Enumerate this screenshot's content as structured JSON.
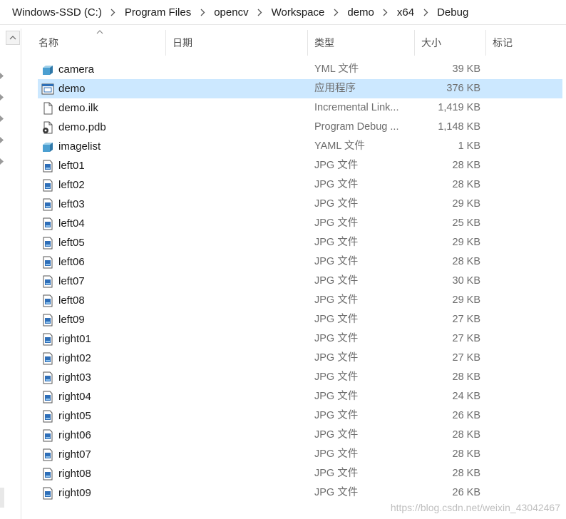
{
  "breadcrumb": [
    "Windows-SSD (C:)",
    "Program Files",
    "opencv",
    "Workspace",
    "demo",
    "x64",
    "Debug"
  ],
  "columns": {
    "name": "名称",
    "date": "日期",
    "type": "类型",
    "size": "大小",
    "tags": "标记"
  },
  "files": [
    {
      "name": "camera",
      "type": "YML 文件",
      "size": "39 KB",
      "icon": "yml-file-icon",
      "selected": false
    },
    {
      "name": "demo",
      "type": "应用程序",
      "size": "376 KB",
      "icon": "exe-file-icon",
      "selected": true
    },
    {
      "name": "demo.ilk",
      "type": "Incremental Link...",
      "size": "1,419 KB",
      "icon": "ilk-file-icon",
      "selected": false
    },
    {
      "name": "demo.pdb",
      "type": "Program Debug ...",
      "size": "1,148 KB",
      "icon": "pdb-file-icon",
      "selected": false
    },
    {
      "name": "imagelist",
      "type": "YAML 文件",
      "size": "1 KB",
      "icon": "yml-file-icon",
      "selected": false
    },
    {
      "name": "left01",
      "type": "JPG 文件",
      "size": "28 KB",
      "icon": "jpg-file-icon",
      "selected": false
    },
    {
      "name": "left02",
      "type": "JPG 文件",
      "size": "28 KB",
      "icon": "jpg-file-icon",
      "selected": false
    },
    {
      "name": "left03",
      "type": "JPG 文件",
      "size": "29 KB",
      "icon": "jpg-file-icon",
      "selected": false
    },
    {
      "name": "left04",
      "type": "JPG 文件",
      "size": "25 KB",
      "icon": "jpg-file-icon",
      "selected": false
    },
    {
      "name": "left05",
      "type": "JPG 文件",
      "size": "29 KB",
      "icon": "jpg-file-icon",
      "selected": false
    },
    {
      "name": "left06",
      "type": "JPG 文件",
      "size": "28 KB",
      "icon": "jpg-file-icon",
      "selected": false
    },
    {
      "name": "left07",
      "type": "JPG 文件",
      "size": "30 KB",
      "icon": "jpg-file-icon",
      "selected": false
    },
    {
      "name": "left08",
      "type": "JPG 文件",
      "size": "29 KB",
      "icon": "jpg-file-icon",
      "selected": false
    },
    {
      "name": "left09",
      "type": "JPG 文件",
      "size": "27 KB",
      "icon": "jpg-file-icon",
      "selected": false
    },
    {
      "name": "right01",
      "type": "JPG 文件",
      "size": "27 KB",
      "icon": "jpg-file-icon",
      "selected": false
    },
    {
      "name": "right02",
      "type": "JPG 文件",
      "size": "27 KB",
      "icon": "jpg-file-icon",
      "selected": false
    },
    {
      "name": "right03",
      "type": "JPG 文件",
      "size": "28 KB",
      "icon": "jpg-file-icon",
      "selected": false
    },
    {
      "name": "right04",
      "type": "JPG 文件",
      "size": "24 KB",
      "icon": "jpg-file-icon",
      "selected": false
    },
    {
      "name": "right05",
      "type": "JPG 文件",
      "size": "26 KB",
      "icon": "jpg-file-icon",
      "selected": false
    },
    {
      "name": "right06",
      "type": "JPG 文件",
      "size": "28 KB",
      "icon": "jpg-file-icon",
      "selected": false
    },
    {
      "name": "right07",
      "type": "JPG 文件",
      "size": "28 KB",
      "icon": "jpg-file-icon",
      "selected": false
    },
    {
      "name": "right08",
      "type": "JPG 文件",
      "size": "28 KB",
      "icon": "jpg-file-icon",
      "selected": false
    },
    {
      "name": "right09",
      "type": "JPG 文件",
      "size": "26 KB",
      "icon": "jpg-file-icon",
      "selected": false
    }
  ],
  "watermark": "https://blog.csdn.net/weixin_43042467",
  "colors": {
    "selection": "#cce8ff",
    "secondary_text": "#6d6d6d",
    "header_text": "#4d4d4d"
  }
}
